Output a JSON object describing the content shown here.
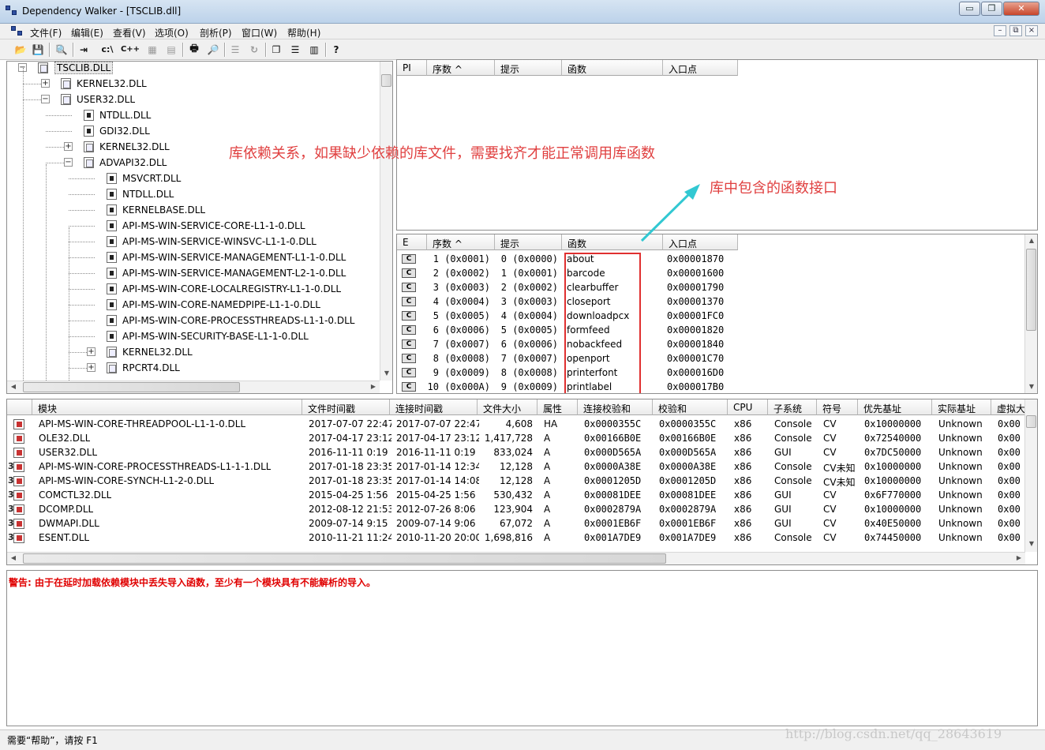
{
  "window": {
    "title": "Dependency Walker - [TSCLIB.dll]",
    "controls": {
      "minimize": "▭",
      "restore": "❐",
      "close": "✕"
    }
  },
  "menu": [
    "文件(F)",
    "编辑(E)",
    "查看(V)",
    "选项(O)",
    "剖析(P)",
    "窗口(W)",
    "帮助(H)"
  ],
  "mdi_controls": {
    "minimize": "–",
    "restore": "⧉",
    "close": "×"
  },
  "toolbar": {
    "items": [
      {
        "name": "open-icon",
        "glyph": "📂"
      },
      {
        "name": "save-icon",
        "glyph": "💾"
      },
      {
        "name": "copy-icon",
        "glyph": "⎘"
      },
      {
        "name": "find-icon",
        "glyph": "🔍"
      },
      {
        "name": "auto-expand-icon",
        "glyph": "⇥"
      },
      {
        "name": "full-paths-icon",
        "glyph": "c:\\"
      },
      {
        "name": "undecorate-cpp-icon",
        "glyph": "C++"
      },
      {
        "name": "view-module-icon",
        "glyph": "▦"
      },
      {
        "name": "properties-icon",
        "glyph": "▤"
      },
      {
        "name": "system-info-icon",
        "glyph": "🖶"
      },
      {
        "name": "external-viewer-icon",
        "glyph": "🔎"
      },
      {
        "name": "configure-icon",
        "glyph": "☰"
      },
      {
        "name": "refresh-icon",
        "glyph": "↻"
      },
      {
        "name": "cascade-icon",
        "glyph": "❐"
      },
      {
        "name": "tile-horizontal-icon",
        "glyph": "☰"
      },
      {
        "name": "tile-vertical-icon",
        "glyph": "▥"
      },
      {
        "name": "help-icon",
        "glyph": "?"
      }
    ]
  },
  "tree": [
    {
      "label": "TSCLIB.DLL",
      "level": 0,
      "expander": "−",
      "selected": true
    },
    {
      "label": "KERNEL32.DLL",
      "level": 1,
      "expander": "+"
    },
    {
      "label": "USER32.DLL",
      "level": 1,
      "expander": "−"
    },
    {
      "label": "NTDLL.DLL",
      "level": 2,
      "expander": ""
    },
    {
      "label": "GDI32.DLL",
      "level": 2,
      "expander": ""
    },
    {
      "label": "KERNEL32.DLL",
      "level": 2,
      "expander": "+"
    },
    {
      "label": "ADVAPI32.DLL",
      "level": 2,
      "expander": "−"
    },
    {
      "label": "MSVCRT.DLL",
      "level": 3,
      "expander": ""
    },
    {
      "label": "NTDLL.DLL",
      "level": 3,
      "expander": ""
    },
    {
      "label": "KERNELBASE.DLL",
      "level": 3,
      "expander": ""
    },
    {
      "label": "API-MS-WIN-SERVICE-CORE-L1-1-0.DLL",
      "level": 3,
      "expander": ""
    },
    {
      "label": "API-MS-WIN-SERVICE-WINSVC-L1-1-0.DLL",
      "level": 3,
      "expander": ""
    },
    {
      "label": "API-MS-WIN-SERVICE-MANAGEMENT-L1-1-0.DLL",
      "level": 3,
      "expander": ""
    },
    {
      "label": "API-MS-WIN-SERVICE-MANAGEMENT-L2-1-0.DLL",
      "level": 3,
      "expander": ""
    },
    {
      "label": "API-MS-WIN-CORE-LOCALREGISTRY-L1-1-0.DLL",
      "level": 3,
      "expander": ""
    },
    {
      "label": "API-MS-WIN-CORE-NAMEDPIPE-L1-1-0.DLL",
      "level": 3,
      "expander": ""
    },
    {
      "label": "API-MS-WIN-CORE-PROCESSTHREADS-L1-1-0.DLL",
      "level": 3,
      "expander": ""
    },
    {
      "label": "API-MS-WIN-SECURITY-BASE-L1-1-0.DLL",
      "level": 3,
      "expander": ""
    },
    {
      "label": "KERNEL32.DLL",
      "level": 3,
      "expander": "+"
    },
    {
      "label": "RPCRT4.DLL",
      "level": 3,
      "expander": "+"
    }
  ],
  "imports": {
    "headers": [
      "PI",
      "序数 ^",
      "提示",
      "函数",
      "入口点"
    ]
  },
  "exports": {
    "headers": [
      "E",
      "序数 ^",
      "提示",
      "函数",
      "入口点"
    ],
    "rows": [
      {
        "e": "C",
        "ordinal": "1 (0x0001)",
        "hint": "0 (0x0000)",
        "function": "about",
        "entry": "0x00001870"
      },
      {
        "e": "C",
        "ordinal": "2 (0x0002)",
        "hint": "1 (0x0001)",
        "function": "barcode",
        "entry": "0x00001600"
      },
      {
        "e": "C",
        "ordinal": "3 (0x0003)",
        "hint": "2 (0x0002)",
        "function": "clearbuffer",
        "entry": "0x00001790"
      },
      {
        "e": "C",
        "ordinal": "4 (0x0004)",
        "hint": "3 (0x0003)",
        "function": "closeport",
        "entry": "0x00001370"
      },
      {
        "e": "C",
        "ordinal": "5 (0x0005)",
        "hint": "4 (0x0004)",
        "function": "downloadpcx",
        "entry": "0x00001FC0"
      },
      {
        "e": "C",
        "ordinal": "6 (0x0006)",
        "hint": "5 (0x0005)",
        "function": "formfeed",
        "entry": "0x00001820"
      },
      {
        "e": "C",
        "ordinal": "7 (0x0007)",
        "hint": "6 (0x0006)",
        "function": "nobackfeed",
        "entry": "0x00001840"
      },
      {
        "e": "C",
        "ordinal": "8 (0x0008)",
        "hint": "7 (0x0007)",
        "function": "openport",
        "entry": "0x00001C70"
      },
      {
        "e": "C",
        "ordinal": "9 (0x0009)",
        "hint": "8 (0x0008)",
        "function": "printerfont",
        "entry": "0x000016D0"
      },
      {
        "e": "C",
        "ordinal": "10 (0x000A)",
        "hint": "9 (0x0009)",
        "function": "printlabel",
        "entry": "0x000017B0"
      }
    ]
  },
  "modules": {
    "headers": [
      "",
      "模块",
      "文件时间戳",
      "连接时间戳",
      "文件大小",
      "属性",
      "连接校验和",
      "校验和",
      "CPU",
      "子系统",
      "符号",
      "优先基址",
      "实际基址",
      "虚拟大"
    ],
    "rows": [
      {
        "icon": "1",
        "module": "API-MS-WIN-CORE-THREADPOOL-L1-1-0.DLL",
        "file_time": "2017-07-07 22:47",
        "link_time": "2017-07-07 22:47",
        "size": "4,608",
        "attr": "HA",
        "link_checksum": "0x0000355C",
        "checksum": "0x0000355C",
        "cpu": "x86",
        "subsystem": "Console",
        "symbols": "CV",
        "pref_base": "0x10000000",
        "actual_base": "Unknown",
        "virtual": "0x00"
      },
      {
        "icon": "1",
        "module": "OLE32.DLL",
        "file_time": "2017-04-17 23:12",
        "link_time": "2017-04-17 23:12",
        "size": "1,417,728",
        "attr": "A",
        "link_checksum": "0x00166B0E",
        "checksum": "0x00166B0E",
        "cpu": "x86",
        "subsystem": "Console",
        "symbols": "CV",
        "pref_base": "0x72540000",
        "actual_base": "Unknown",
        "virtual": "0x00"
      },
      {
        "icon": "1",
        "module": "USER32.DLL",
        "file_time": "2016-11-11  0:19",
        "link_time": "2016-11-11  0:19",
        "size": "833,024",
        "attr": "A",
        "link_checksum": "0x000D565A",
        "checksum": "0x000D565A",
        "cpu": "x86",
        "subsystem": "GUI",
        "symbols": "CV",
        "pref_base": "0x7DC50000",
        "actual_base": "Unknown",
        "virtual": "0x00"
      },
      {
        "icon": "3",
        "module": "API-MS-WIN-CORE-PROCESSTHREADS-L1-1-1.DLL",
        "file_time": "2017-01-18 23:35",
        "link_time": "2017-01-14 12:34",
        "size": "12,128",
        "attr": "A",
        "link_checksum": "0x0000A38E",
        "checksum": "0x0000A38E",
        "cpu": "x86",
        "subsystem": "Console",
        "symbols": "CV未知",
        "pref_base": "0x10000000",
        "actual_base": "Unknown",
        "virtual": "0x00"
      },
      {
        "icon": "3",
        "module": "API-MS-WIN-CORE-SYNCH-L1-2-0.DLL",
        "file_time": "2017-01-18 23:35",
        "link_time": "2017-01-14 14:08",
        "size": "12,128",
        "attr": "A",
        "link_checksum": "0x0001205D",
        "checksum": "0x0001205D",
        "cpu": "x86",
        "subsystem": "Console",
        "symbols": "CV未知",
        "pref_base": "0x10000000",
        "actual_base": "Unknown",
        "virtual": "0x00"
      },
      {
        "icon": "3",
        "module": "COMCTL32.DLL",
        "file_time": "2015-04-25  1:56",
        "link_time": "2015-04-25  1:56",
        "size": "530,432",
        "attr": "A",
        "link_checksum": "0x00081DEE",
        "checksum": "0x00081DEE",
        "cpu": "x86",
        "subsystem": "GUI",
        "symbols": "CV",
        "pref_base": "0x6F770000",
        "actual_base": "Unknown",
        "virtual": "0x00"
      },
      {
        "icon": "3",
        "module": "DCOMP.DLL",
        "file_time": "2012-08-12 21:53",
        "link_time": "2012-07-26  8:06",
        "size": "123,904",
        "attr": "A",
        "link_checksum": "0x0002879A",
        "checksum": "0x0002879A",
        "cpu": "x86",
        "subsystem": "GUI",
        "symbols": "CV",
        "pref_base": "0x10000000",
        "actual_base": "Unknown",
        "virtual": "0x00"
      },
      {
        "icon": "3",
        "module": "DWMAPI.DLL",
        "file_time": "2009-07-14  9:15",
        "link_time": "2009-07-14  9:06",
        "size": "67,072",
        "attr": "A",
        "link_checksum": "0x0001EB6F",
        "checksum": "0x0001EB6F",
        "cpu": "x86",
        "subsystem": "GUI",
        "symbols": "CV",
        "pref_base": "0x40E50000",
        "actual_base": "Unknown",
        "virtual": "0x00"
      },
      {
        "icon": "3",
        "module": "ESENT.DLL",
        "file_time": "2010-11-21 11:24",
        "link_time": "2010-11-20 20:00",
        "size": "1,698,816",
        "attr": "A",
        "link_checksum": "0x001A7DE9",
        "checksum": "0x001A7DE9",
        "cpu": "x86",
        "subsystem": "Console",
        "symbols": "CV",
        "pref_base": "0x74450000",
        "actual_base": "Unknown",
        "virtual": "0x00"
      }
    ]
  },
  "log": {
    "warning": "警告: 由于在延时加载依赖模块中丢失导入函数，至少有一个模块具有不能解析的导入。"
  },
  "status": {
    "text": "需要“帮助”，请按 F1"
  },
  "annotations": {
    "deps_note": "库依赖关系，如果缺少依赖的库文件，需要找齐才能正常调用库函数",
    "funcs_note": "库中包含的函数接口",
    "watermark": "http://blog.csdn.net/qq_28643619"
  },
  "colors": {
    "annotation": "#e04040",
    "highlight_box": "#e03030",
    "arrow": "#32c8d2",
    "warning": "#e00000"
  }
}
